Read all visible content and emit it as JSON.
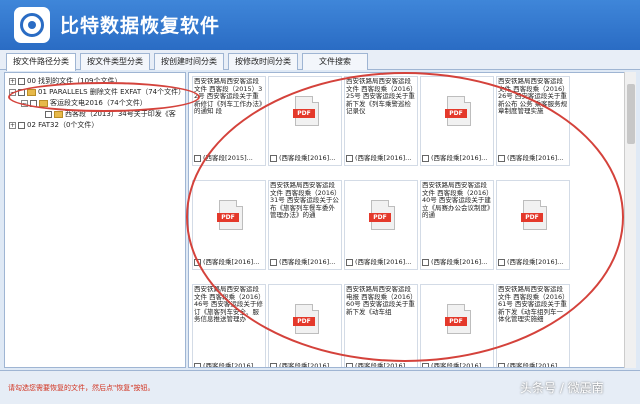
{
  "app": {
    "title": "比特数据恢复软件"
  },
  "tabs": [
    {
      "label": "按文件路径分类"
    },
    {
      "label": "按文件类型分类"
    },
    {
      "label": "按创建时间分类"
    },
    {
      "label": "按修改时间分类"
    },
    {
      "label": "文件搜索"
    }
  ],
  "tree": {
    "nodes": [
      {
        "label": "00 找到的文件（109个文件）"
      },
      {
        "label": "01 PARALLELS 删除文件 EXFAT（74个文件）"
      },
      {
        "label": "客运段文电2016（74个文件）"
      },
      {
        "label": "西客段（2013）34号关于印发《客"
      },
      {
        "label": "02 FAT32（0个文件）"
      }
    ]
  },
  "grid": {
    "cells": [
      {
        "type": "text",
        "preview": "西安铁路局西安客运段文件 西客段（2015）32号 西安客运段关于重新修订《列车工作办法》的通知 段",
        "name": "(西客段[2015]..."
      },
      {
        "type": "pdf",
        "name": "(西客段乘[2016]..."
      },
      {
        "type": "text",
        "preview": "西安铁路局西安客运段文件 西客段乘（2016）25号 西安客运段关于重新下发《列车乘警巡检记录仪",
        "name": "(西客段乘[2016]..."
      },
      {
        "type": "pdf",
        "name": "(西客段乘[2016]..."
      },
      {
        "type": "text",
        "preview": "西安铁路局西安客运段文件 西客段乘（2016）26号 西安客运段关于重新公布 公务 乘客服务规章制度管理实施",
        "name": "(西客段乘[2016]..."
      },
      {
        "type": "pdf",
        "name": "(西客段乘[2016]..."
      },
      {
        "type": "text",
        "preview": "西安铁路局西安客运段文件 西客段乘（2016）31号 西安客运段关于公布《旅客列车餐车委外管理办法》的通",
        "name": "(西客段乘[2016]..."
      },
      {
        "type": "pdf",
        "name": "(西客段乘[2016]..."
      },
      {
        "type": "text",
        "preview": "西安铁路局西安客运段文件 西客段乘（2016）40号 西安客运段关于建立《局赛办公会议制度》的通",
        "name": "(西客段乘[2016]..."
      },
      {
        "type": "pdf",
        "name": "(西客段乘[2016]..."
      },
      {
        "type": "text",
        "preview": "西安铁路局西安客运段文件 西客段乘（2016）46号 西安客运段关于修订《旅客列车安全、服务信息推送管理办",
        "name": "(西客段乘[2016]..."
      },
      {
        "type": "pdf",
        "name": "(西客段乘[2016]..."
      },
      {
        "type": "text",
        "preview": "西安铁路局西安客运段电报 西客段乘（2016）60号 西安客运段关于重新下发《动车组",
        "name": "(西客段乘[2016]..."
      },
      {
        "type": "pdf",
        "name": "(西客段乘[2016]..."
      },
      {
        "type": "text",
        "preview": "西安铁路局西安客运段文件 西客段乘（2016）61号 西安客运段关于重新下发《动车组列车一体化管理实施细",
        "name": "(西客段乘[2016]..."
      }
    ]
  },
  "status": {
    "hint": "请勾选您需要恢复的文件，然后点\"恢复\"按钮。"
  },
  "watermark": "头条号 / 微震南",
  "colors": {
    "accent": "#2a6cc4",
    "annotation": "#d4423b",
    "pdf": "#e4392b"
  }
}
